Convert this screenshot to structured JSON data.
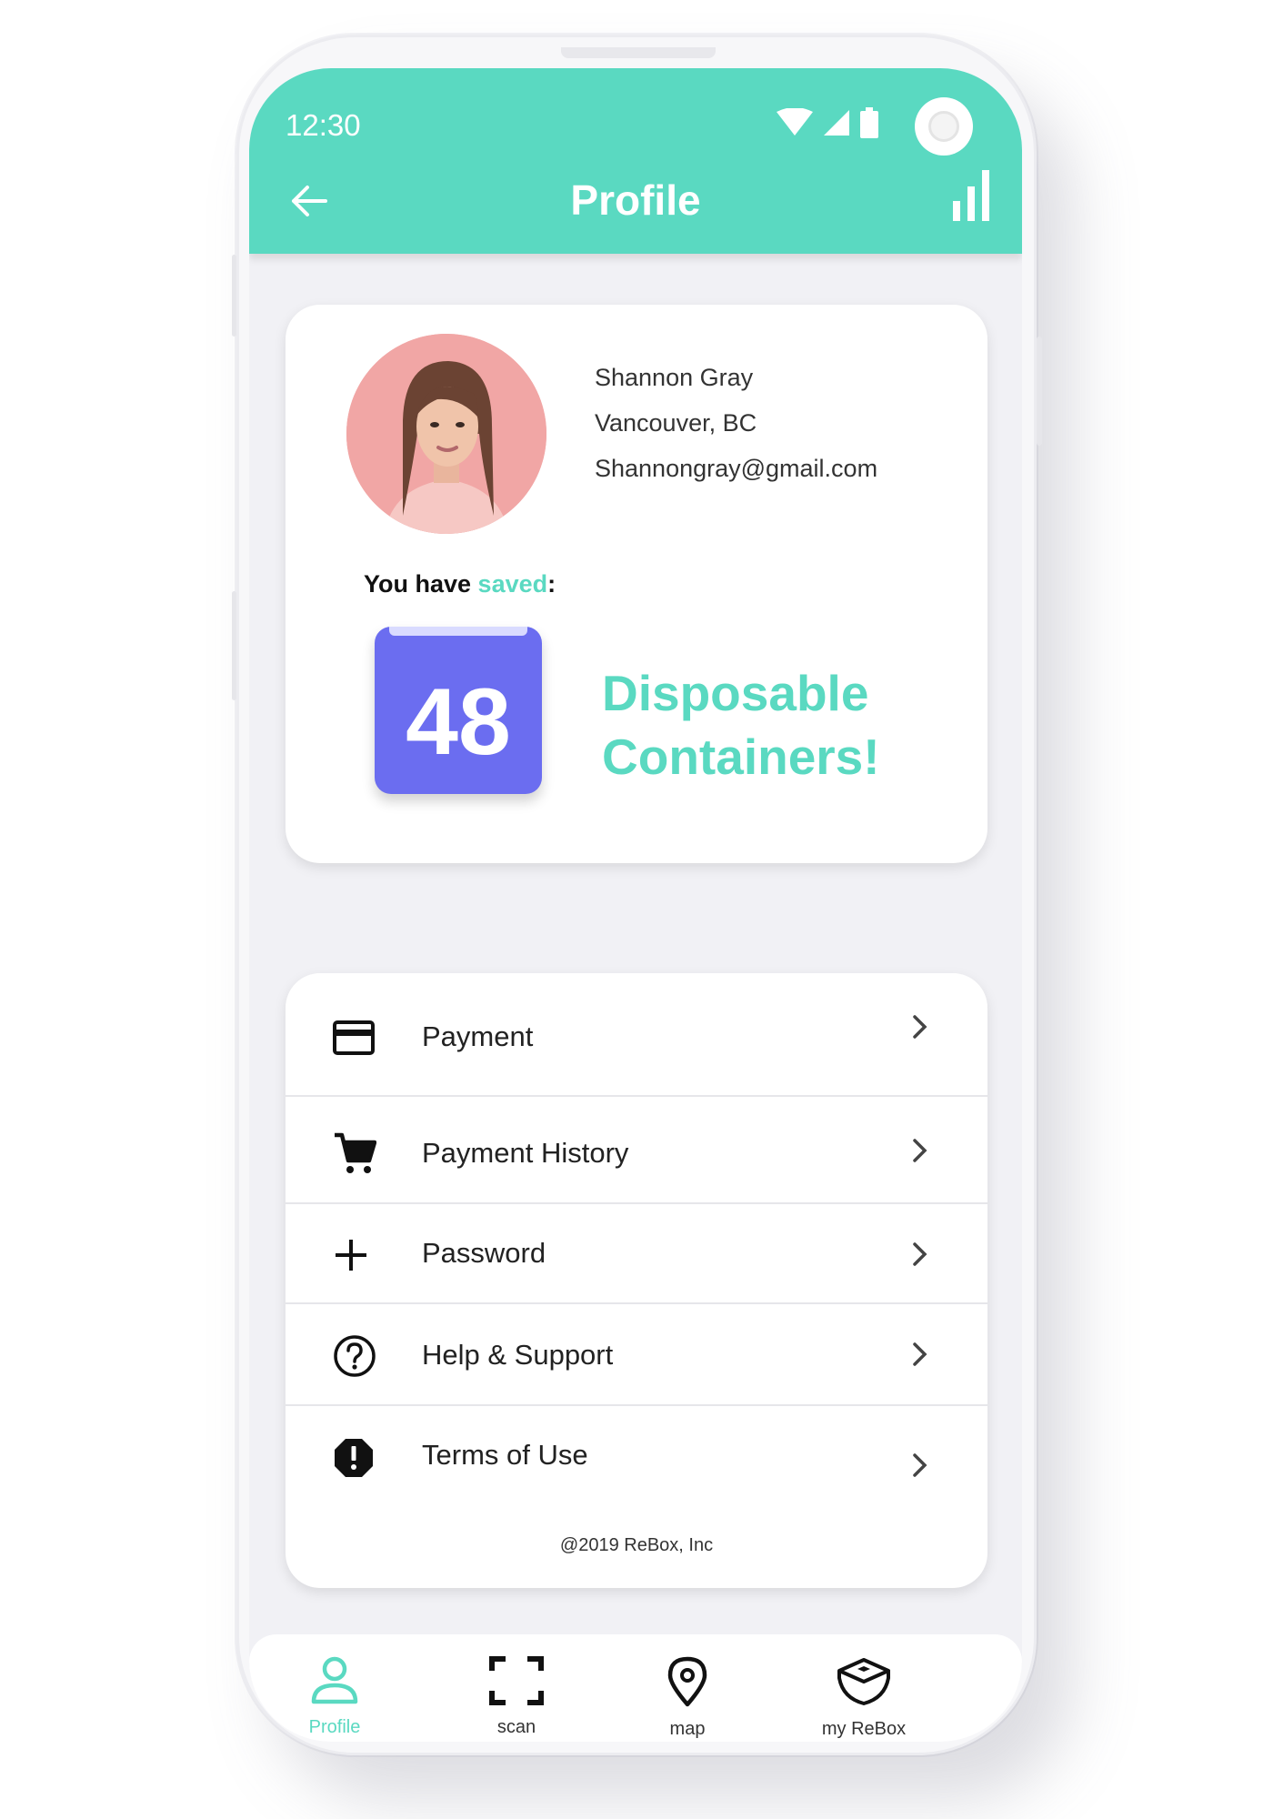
{
  "status_bar": {
    "time": "12:30"
  },
  "header": {
    "title": "Profile"
  },
  "profile": {
    "name": "Shannon Gray",
    "location": "Vancouver, BC",
    "email": "Shannongray@gmail.com"
  },
  "savings": {
    "prefix": "You have ",
    "highlight": "saved",
    "suffix": ":",
    "count": "48",
    "line1": "Disposable",
    "line2": "Containers!"
  },
  "menu": {
    "items": [
      {
        "label": "Payment",
        "icon": "credit-card-icon"
      },
      {
        "label": "Payment History",
        "icon": "cart-icon"
      },
      {
        "label": "Password",
        "icon": "plus-icon"
      },
      {
        "label": "Help & Support",
        "icon": "help-circle-icon"
      },
      {
        "label": "Terms of Use",
        "icon": "alert-octagon-icon"
      }
    ],
    "copyright": "@2019 ReBox, Inc"
  },
  "bottom_nav": {
    "items": [
      {
        "label": "Profile",
        "icon": "person-icon",
        "active": true
      },
      {
        "label": "scan",
        "icon": "scan-frame-icon",
        "active": false
      },
      {
        "label": "map",
        "icon": "map-pin-icon",
        "active": false
      },
      {
        "label": "my ReBox",
        "icon": "box-icon",
        "active": false
      }
    ]
  },
  "colors": {
    "accent": "#5ad9c1",
    "counter": "#6b6df0",
    "background": "#f1f1f5"
  }
}
